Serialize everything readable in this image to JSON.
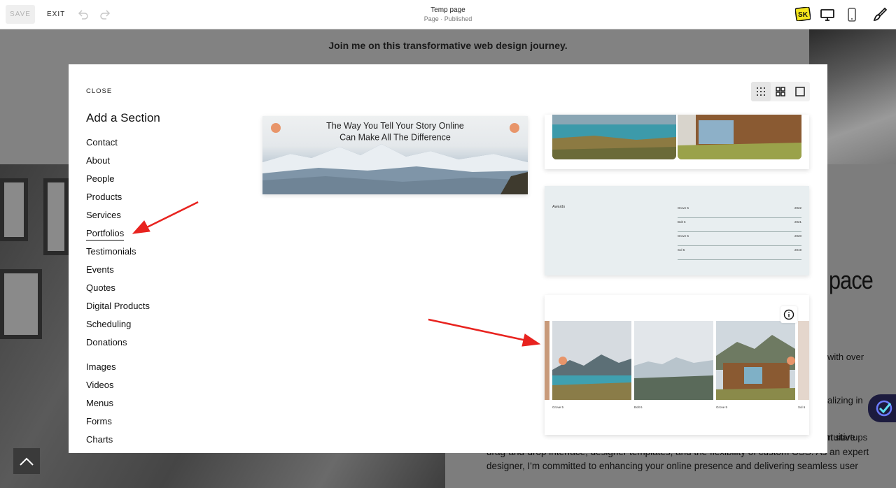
{
  "topbar": {
    "save_label": "SAVE",
    "exit_label": "EXIT",
    "page_title": "Temp page",
    "page_status": "Page · Published",
    "sk_badge": "SK"
  },
  "background": {
    "headline": "Join me on this transformative web design journey.",
    "word_pace": "pace",
    "text_with_over": "with over",
    "text_alizing_in": "alizing in",
    "text_n_startups": "n startups",
    "paragraph": "to creative professionals, offering tailored solutions that leverage Squarespace's intuitive drag-and-drop interface, designer templates, and the flexibility of custom CSS. As an expert designer, I'm committed to enhancing your online presence and delivering seamless user"
  },
  "modal": {
    "close_label": "CLOSE",
    "title": "Add a Section",
    "sections": [
      {
        "label": "Contact"
      },
      {
        "label": "About"
      },
      {
        "label": "People"
      },
      {
        "label": "Products"
      },
      {
        "label": "Services"
      },
      {
        "label": "Portfolios",
        "active": true
      },
      {
        "label": "Testimonials"
      },
      {
        "label": "Events"
      },
      {
        "label": "Quotes"
      },
      {
        "label": "Digital Products"
      },
      {
        "label": "Scheduling"
      },
      {
        "label": "Donations"
      },
      {
        "label": "Images"
      },
      {
        "label": "Videos"
      },
      {
        "label": "Menus"
      },
      {
        "label": "Forms"
      },
      {
        "label": "Charts"
      }
    ],
    "hero_preview": {
      "line1": "The Way You Tell Your Story Online",
      "line2": "Can Make All The Difference"
    },
    "awards_preview": {
      "label": "Awards",
      "rows": [
        {
          "name": "Grove 5",
          "year": "2022"
        },
        {
          "name": "Bolt 6",
          "year": "2021"
        },
        {
          "name": "Grove 5",
          "year": "2020"
        },
        {
          "name": "Sol 5",
          "year": "2019"
        }
      ]
    },
    "portfolio_preview": {
      "captions": [
        "Grove 5",
        "Bolt 6",
        "Grove 5",
        "Sol 6"
      ]
    }
  },
  "colors": {
    "accent_dot": "#e8956a",
    "annotation_arrow": "#e8231f",
    "assistant_badge": "#1c1b3e"
  }
}
